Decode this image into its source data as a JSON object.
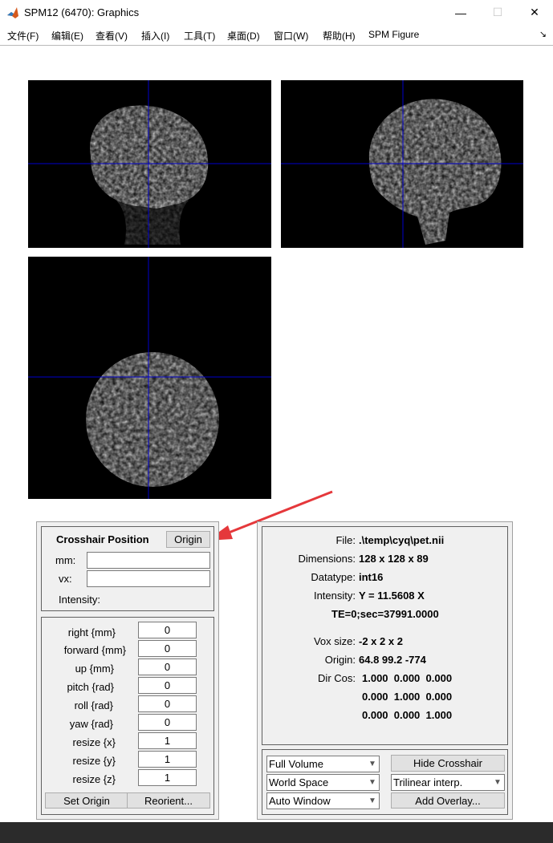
{
  "window": {
    "title": "SPM12 (6470): Graphics",
    "minimize_glyph": "—",
    "maximize_glyph": "☐",
    "close_glyph": "✕"
  },
  "menu": {
    "items": [
      "文件(F)",
      "编辑(E)",
      "查看(V)",
      "插入(I)",
      "工具(T)",
      "桌面(D)",
      "窗口(W)",
      "帮助(H)",
      "SPM Figure"
    ],
    "dock_glyph": "↘"
  },
  "crosshair": {
    "title": "Crosshair Position",
    "origin_button": "Origin",
    "mm_label": "mm:",
    "mm_value": "",
    "vx_label": "vx:",
    "vx_value": "",
    "intensity_label": "Intensity:"
  },
  "reorient": {
    "rows": [
      {
        "label": "right  {mm}",
        "value": "0"
      },
      {
        "label": "forward  {mm}",
        "value": "0"
      },
      {
        "label": "up  {mm}",
        "value": "0"
      },
      {
        "label": "pitch  {rad}",
        "value": "0"
      },
      {
        "label": "roll  {rad}",
        "value": "0"
      },
      {
        "label": "yaw  {rad}",
        "value": "0"
      },
      {
        "label": "resize  {x}",
        "value": "1"
      },
      {
        "label": "resize  {y}",
        "value": "1"
      },
      {
        "label": "resize  {z}",
        "value": "1"
      }
    ],
    "set_origin_button": "Set Origin",
    "reorient_button": "Reorient..."
  },
  "info": {
    "file_label": "File:",
    "file_value": ".\\temp\\cyq\\pet.nii",
    "dimensions_label": "Dimensions:",
    "dimensions_value": "128 x 128 x 89",
    "datatype_label": "Datatype:",
    "datatype_value": "int16",
    "intensity_label": "Intensity:",
    "intensity_value": "Y = 11.5608 X",
    "te_value": "TE=0;sec=37991.0000",
    "voxsize_label": "Vox size:",
    "voxsize_value": "-2 x 2 x 2",
    "origin_label": "Origin:",
    "origin_value": "64.8 99.2 -774",
    "dircos_label": "Dir Cos:",
    "dircos_rows": [
      "1.000  0.000  0.000",
      "0.000  1.000  0.000",
      "0.000  0.000  1.000"
    ]
  },
  "controls": {
    "volume_select": "Full Volume",
    "space_select": "World Space",
    "window_select": "Auto Window",
    "hide_crosshair_button": "Hide Crosshair",
    "interp_select": "Trilinear interp.",
    "add_overlay_button": "Add Overlay..."
  },
  "colors": {
    "crosshair": "#0000cc",
    "annotation_arrow": "#e5383b",
    "panel_bg": "#f0f0f0",
    "button_bg": "#e1e1e1"
  },
  "icons": {
    "app": "matlab-icon",
    "dropdown": "chevron-down-icon"
  }
}
